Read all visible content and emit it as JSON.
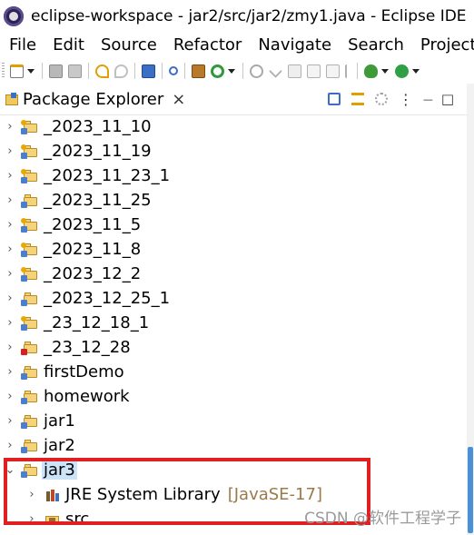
{
  "window": {
    "title": "eclipse-workspace - jar2/src/jar2/zmy1.java - Eclipse IDE"
  },
  "menu": {
    "items": [
      "File",
      "Edit",
      "Source",
      "Refactor",
      "Navigate",
      "Search",
      "Project"
    ]
  },
  "toolbar": {
    "icons": [
      "new-icon",
      "save-icon",
      "save-all-icon",
      "undo-icon",
      "redo-icon",
      "terminal-icon",
      "toggle-breakpoint-icon",
      "open-type-icon",
      "refresh-icon",
      "hierarchy-icon",
      "search-icon",
      "pilcrow-icon",
      "debug-icon",
      "run-icon"
    ]
  },
  "view": {
    "title": "Package Explorer",
    "close_glyph": "×",
    "menu_glyph": "⋮",
    "minimize_glyph": "—",
    "maximize_glyph": "□"
  },
  "tree": {
    "collapsed_glyph": "›",
    "expanded_glyph": "⌄",
    "items": [
      {
        "label": "_2023_11_10",
        "badge": "warn"
      },
      {
        "label": "_2023_11_19",
        "badge": "warn"
      },
      {
        "label": "_2023_11_23_1",
        "badge": "warn"
      },
      {
        "label": "_2023_11_25",
        "badge": "none"
      },
      {
        "label": "_2023_11_5",
        "badge": "warn"
      },
      {
        "label": "_2023_11_8",
        "badge": "warn"
      },
      {
        "label": "_2023_12_2",
        "badge": "warn"
      },
      {
        "label": "_2023_12_25_1",
        "badge": "none"
      },
      {
        "label": "_23_12_18_1",
        "badge": "warn"
      },
      {
        "label": "_23_12_28",
        "badge": "error"
      },
      {
        "label": "firstDemo",
        "badge": "none"
      },
      {
        "label": "homework",
        "badge": "none"
      },
      {
        "label": "jar1",
        "badge": "none"
      },
      {
        "label": "jar2",
        "badge": "none"
      }
    ],
    "expanded_project": {
      "label": "jar3",
      "children": [
        {
          "label": "JRE System Library",
          "tag": "[JavaSE-17]",
          "icon": "library-icon"
        },
        {
          "label": "src",
          "tag": "",
          "icon": "source-folder-icon"
        }
      ]
    }
  },
  "watermark": "CSDN @软件工程学子",
  "colors": {
    "selection": "#cce4f7",
    "annotation_box": "#e02020",
    "scrollbar_thumb": "#4a90d9",
    "jre_tag": "#9a7a4a"
  }
}
